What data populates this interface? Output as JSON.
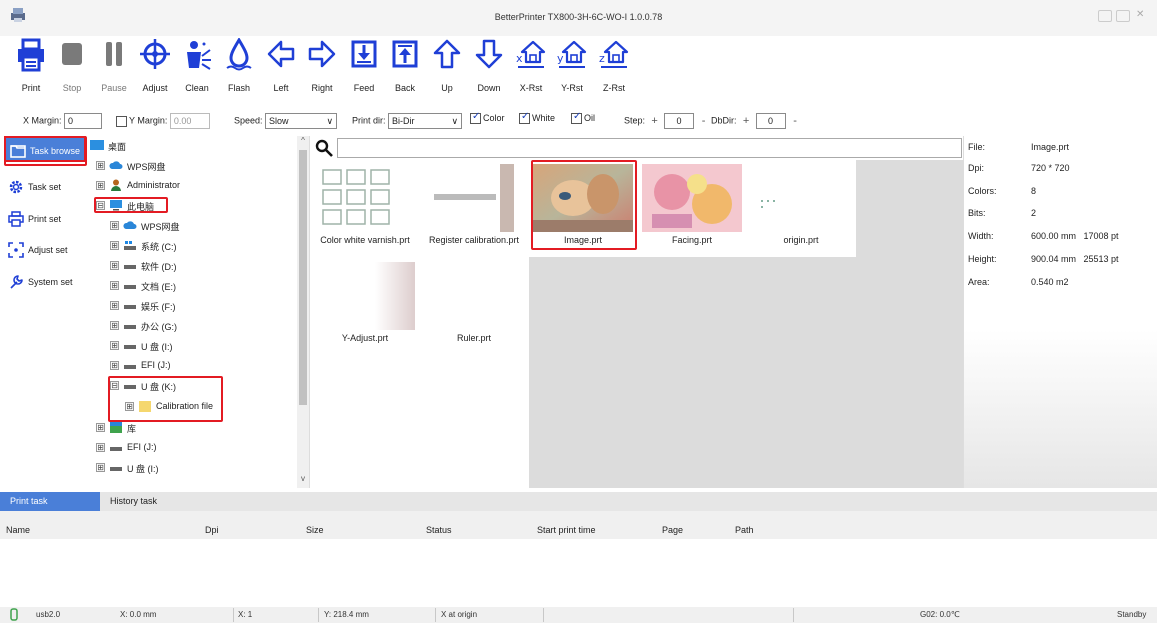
{
  "window": {
    "title": "BetterPrinter TX800-3H-6C-WO-I 1.0.0.78"
  },
  "toolbar": {
    "buttons": [
      {
        "label": "Print",
        "icon": "printer-icon"
      },
      {
        "label": "Stop",
        "icon": "stop-icon"
      },
      {
        "label": "Pause",
        "icon": "pause-icon"
      },
      {
        "label": "Adjust",
        "icon": "crosshair-icon"
      },
      {
        "label": "Clean",
        "icon": "clean-icon"
      },
      {
        "label": "Flash",
        "icon": "flash-drop-icon"
      },
      {
        "label": "Left",
        "icon": "arrow-left-icon"
      },
      {
        "label": "Right",
        "icon": "arrow-right-icon"
      },
      {
        "label": "Feed",
        "icon": "feed-icon"
      },
      {
        "label": "Back",
        "icon": "back-icon"
      },
      {
        "label": "Up",
        "icon": "arrow-up-icon"
      },
      {
        "label": "Down",
        "icon": "arrow-down-icon"
      },
      {
        "label": "X-Rst",
        "icon": "x-reset-icon"
      },
      {
        "label": "Y-Rst",
        "icon": "y-reset-icon"
      },
      {
        "label": "Z-Rst",
        "icon": "z-reset-icon"
      }
    ]
  },
  "settings": {
    "x_margin_label": "X Margin:",
    "x_margin_value": "0",
    "y_margin_label": "Y Margin:",
    "y_margin_value": "0.00",
    "speed_label": "Speed:",
    "speed_value": "Slow",
    "print_dir_label": "Print dir:",
    "print_dir_value": "Bi-Dir",
    "color_label": "Color",
    "white_label": "White",
    "oil_label": "Oil",
    "step_label": "Step:",
    "step_value": "0",
    "dbdir_label": "DbDir:",
    "dbdir_value": "0",
    "plus": "+",
    "minus": "-"
  },
  "nav": {
    "items": [
      {
        "label": "Task browse",
        "icon": "folder-browse-icon"
      },
      {
        "label": "Task set",
        "icon": "gear-icon"
      },
      {
        "label": "Print set",
        "icon": "printer-small-icon"
      },
      {
        "label": "Adjust set",
        "icon": "adjust-icon"
      },
      {
        "label": "System set",
        "icon": "wrench-icon"
      }
    ]
  },
  "tree": {
    "nodes": [
      {
        "label": "桌面",
        "toggle": "",
        "icon": "desktop"
      },
      {
        "label": "WPS网盘",
        "toggle": "⊞",
        "icon": "cloud"
      },
      {
        "label": "Administrator",
        "toggle": "⊞",
        "icon": "user"
      },
      {
        "label": "此电脑",
        "toggle": "⊟",
        "icon": "pc"
      },
      {
        "label": "WPS网盘",
        "toggle": "⊞",
        "icon": "cloud"
      },
      {
        "label": "系统 (C:)",
        "toggle": "⊞",
        "icon": "sysdrive"
      },
      {
        "label": "软件 (D:)",
        "toggle": "⊞",
        "icon": "drive"
      },
      {
        "label": "文档 (E:)",
        "toggle": "⊞",
        "icon": "drive"
      },
      {
        "label": "娱乐 (F:)",
        "toggle": "⊞",
        "icon": "drive"
      },
      {
        "label": "办公 (G:)",
        "toggle": "⊞",
        "icon": "drive"
      },
      {
        "label": "U 盘 (I:)",
        "toggle": "⊞",
        "icon": "drive"
      },
      {
        "label": "EFI (J:)",
        "toggle": "⊞",
        "icon": "drive"
      },
      {
        "label": "U 盘 (K:)",
        "toggle": "⊟",
        "icon": "drive"
      },
      {
        "label": "Calibration file",
        "toggle": "⊞",
        "icon": "folder"
      },
      {
        "label": "库",
        "toggle": "⊞",
        "icon": "library"
      },
      {
        "label": "EFI (J:)",
        "toggle": "⊞",
        "icon": "drive"
      },
      {
        "label": "U 盘 (I:)",
        "toggle": "⊞",
        "icon": "drive"
      }
    ]
  },
  "files": [
    {
      "name": "Color white varnish.prt"
    },
    {
      "name": "Register calibration.prt"
    },
    {
      "name": "Image.prt"
    },
    {
      "name": "Facing.prt"
    },
    {
      "name": "origin.prt"
    },
    {
      "name": "Y-Adjust.prt"
    },
    {
      "name": "Ruler.prt"
    }
  ],
  "info": {
    "rows": [
      {
        "key": "File:",
        "value": "Image.prt"
      },
      {
        "key": "Dpi:",
        "value": "720 * 720"
      },
      {
        "key": "Colors:",
        "value": "8"
      },
      {
        "key": "Bits:",
        "value": "2"
      },
      {
        "key": "Width:",
        "value": "600.00 mm   17008 pt"
      },
      {
        "key": "Height:",
        "value": "900.04 mm   25513 pt"
      },
      {
        "key": "Area:",
        "value": "0.540 m2"
      }
    ]
  },
  "tasks": {
    "tab_print": "Print task",
    "tab_history": "History task",
    "columns": [
      "Name",
      "Dpi",
      "Size",
      "Status",
      "Start print time",
      "Page",
      "Path"
    ]
  },
  "status": {
    "usb": "usb2.0",
    "x_pos": "X: 0.0 mm",
    "x_count": "X: 1",
    "y_pos": "Y: 218.4 mm",
    "x_origin": "X at origin",
    "temp": "G02: 0.0℃",
    "state": "Standby"
  },
  "colors": {
    "accent": "#1f3fd6",
    "nav_active": "#4a7fd8",
    "highlight_box": "#e31b23"
  }
}
